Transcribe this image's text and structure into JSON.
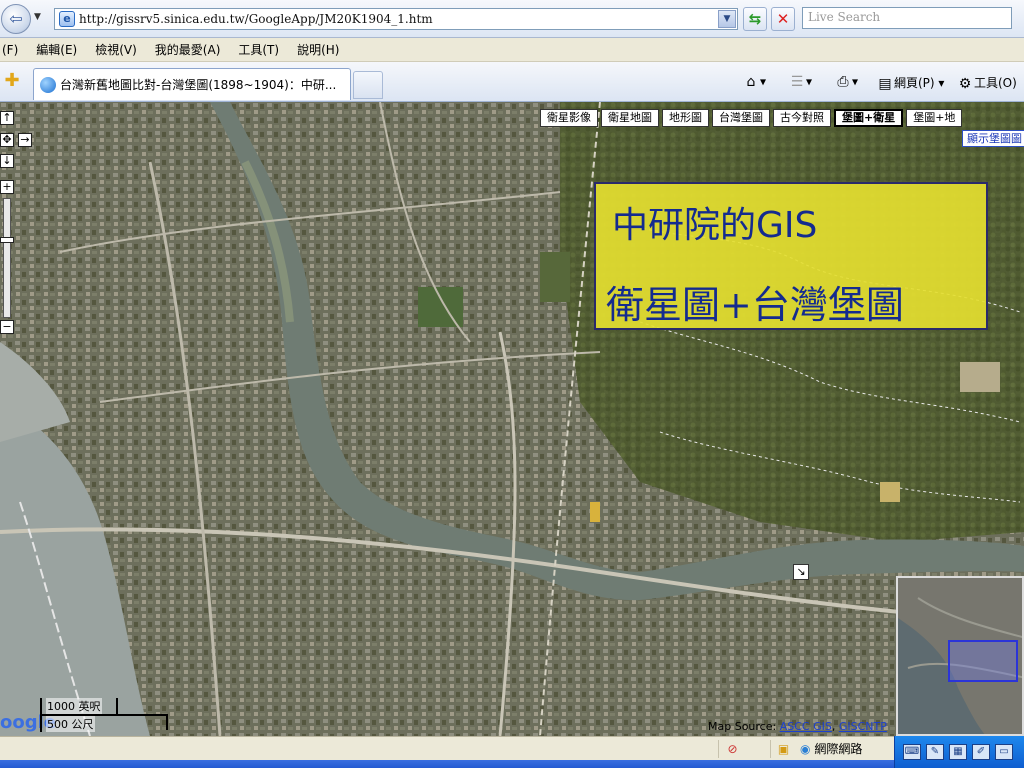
{
  "browser": {
    "url": "http://gissrv5.sinica.edu.tw/GoogleApp/JM20K1904_1.htm",
    "search_placeholder": "Live Search",
    "menu": [
      "(F)",
      "編輯(E)",
      "檢視(V)",
      "我的最愛(A)",
      "工具(T)",
      "說明(H)"
    ],
    "tab_title": "台灣新舊地圖比對-台灣堡圖(1898~1904)：中研...",
    "cmd_page": "網頁(P)",
    "cmd_tools": "工具(O)"
  },
  "map": {
    "layer_buttons": [
      "衛星影像",
      "衛星地圖",
      "地形圖",
      "台灣堡圖",
      "古今對照",
      "堡圖+衛星",
      "堡圖+地"
    ],
    "active_layer": "堡圖+衛星",
    "show_overlay_label": "顯示堡圖圖",
    "title_line1": "中研院的GIS",
    "title_line2": "衛星圖+台灣堡圖",
    "title_color": "#142b8f",
    "scale_top": "1000 英呎",
    "scale_bottom": "500 公尺",
    "logo_text": "oogle",
    "map_source_label": "Map Source:",
    "map_source_link1": "ASCC GIS",
    "map_source_link2": "GISCNTP",
    "controls": {
      "pan_up": "↑",
      "pan_down": "↓",
      "pan_right": "→",
      "center": "✥",
      "zoom_in": "+",
      "zoom_out": "−",
      "overview_toggle": "↘"
    }
  },
  "status": {
    "zone": "網際網路"
  },
  "colors": {
    "accent": "#2b34d8",
    "overlay_yellow": "#e4de30"
  }
}
